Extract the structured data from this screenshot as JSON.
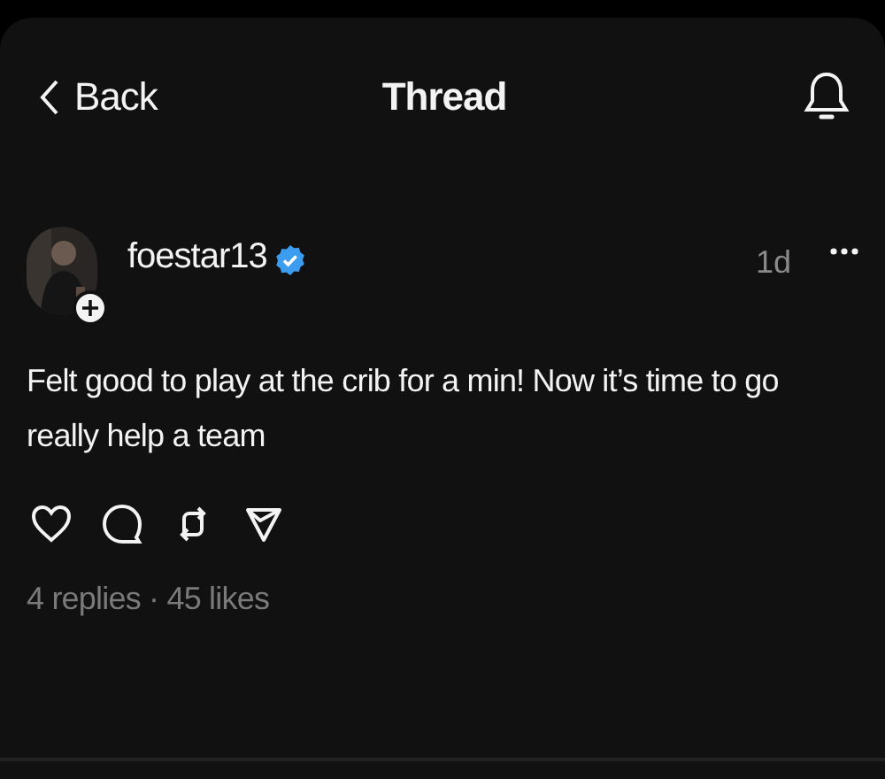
{
  "header": {
    "back_label": "Back",
    "title": "Thread"
  },
  "post": {
    "username": "foestar13",
    "verified": true,
    "time": "1d",
    "text": "Felt good to play at the crib for a min! Now it’s time to go really help a team",
    "liked": false,
    "stats": "4 replies · 45 likes"
  }
}
